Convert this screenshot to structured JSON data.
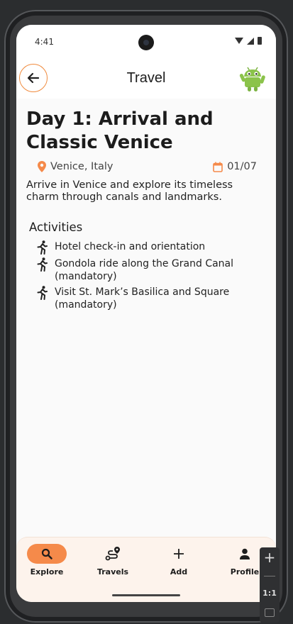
{
  "status_bar": {
    "time": "4:41"
  },
  "app_bar": {
    "title": "Travel"
  },
  "day": {
    "title": "Day 1: Arrival and Classic Venice",
    "location": "Venice, Italy",
    "date": "01/07",
    "description": "Arrive in Venice and explore its timeless charm through canals and landmarks."
  },
  "activities": {
    "heading": "Activities",
    "items": [
      "Hotel check-in and orientation",
      "Gondola ride along the Grand Canal (mandatory)",
      "Visit St. Mark’s Basilica and Square (mandatory)"
    ]
  },
  "bottom_nav": {
    "items": [
      {
        "label": "Explore",
        "icon": "search-icon",
        "active": true
      },
      {
        "label": "Travels",
        "icon": "route-icon",
        "active": false
      },
      {
        "label": "Add",
        "icon": "plus-icon",
        "active": false
      },
      {
        "label": "Profile",
        "icon": "person-icon",
        "active": false
      }
    ]
  },
  "emulator_toolbar": {
    "zoom_label": "1:1"
  },
  "colors": {
    "accent": "#f58a4a",
    "accent_border": "#f08a3c",
    "nav_background": "#fdf3ec",
    "android_green": "#8bc34a"
  }
}
